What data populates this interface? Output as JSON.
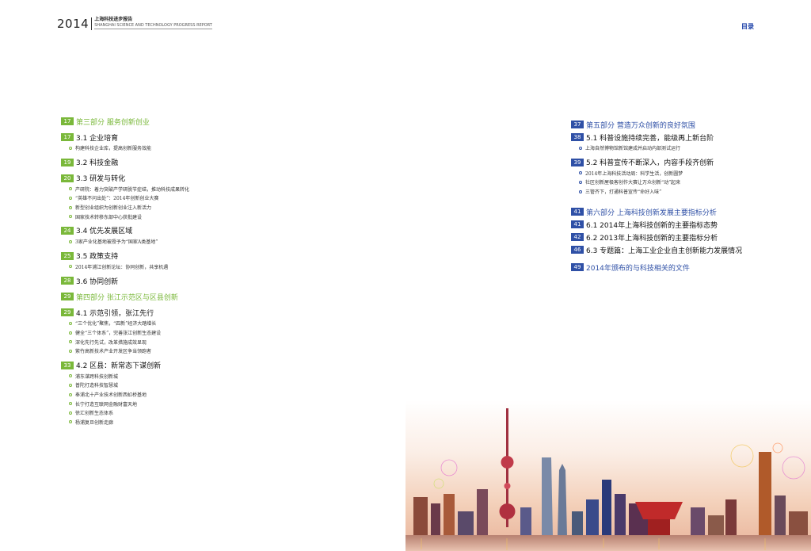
{
  "header": {
    "year": "2014",
    "title_cn": "上海科技进步报告",
    "title_en": "SHANGHAI SCIENCE AND TECHNOLOGY PROGRESS REPORT",
    "toc_link": "目录"
  },
  "left": {
    "part3": {
      "num": "17",
      "label": "第三部分 服务创新创业"
    },
    "s31": {
      "num": "17",
      "label": "3.1 企业培育",
      "items": [
        "构建科技企业库，提高创新服务效能"
      ]
    },
    "s32": {
      "num": "19",
      "label": "3.2 科技金融"
    },
    "s33": {
      "num": "20",
      "label": "3.3 研发与转化",
      "items": [
        "产研院：着力突破产学研脱节症结，推动科技成果转化",
        "“英雄不问出处”：2014年创新创业大赛",
        "新型创业组织为创新创业注入新活力",
        "国家技术转移东部中心获批建设"
      ]
    },
    "s34": {
      "num": "24",
      "label": "3.4 优先发展区域",
      "items": [
        "3家产业化基地被授予为“国家A类基地”"
      ]
    },
    "s35": {
      "num": "25",
      "label": "3.5 政策支持",
      "items": [
        "2014年浦江创新论坛：协同创新，共享机遇"
      ]
    },
    "s36": {
      "num": "28",
      "label": "3.6 协同创新"
    },
    "part4": {
      "num": "29",
      "label": "第四部分 张江示范区与区县创新"
    },
    "s41": {
      "num": "29",
      "label": "4.1 示范引领，张江先行",
      "items": [
        "“三个优化”聚焦，“四新”经济大踏增长",
        "健全“三个体系”，完善张江创新生态建设",
        "深化先行先试，改革措施成效显现",
        "紫竹高新技术产业开发区争当领跑者"
      ]
    },
    "s42": {
      "num": "33",
      "label": "4.2 区县：新常态下谋创新",
      "items": [
        "浦东谋跨科技创新城",
        "普陀打造科技智慧城",
        "奉浦北十产业技术创新西虹桥基地",
        "长宁打造互联网金融财富天地",
        "徐汇创新生态体系",
        "杨浦复旦创新走廊"
      ]
    }
  },
  "right": {
    "part5": {
      "num": "37",
      "label": "第五部分 营造万众创新的良好氛围"
    },
    "s51": {
      "num": "38",
      "label": "5.1 科普设施持续完善，能级再上新台阶",
      "items": [
        "上海自然博物馆新馆建成并启动内部测试运行"
      ]
    },
    "s52": {
      "num": "39",
      "label": "5.2 科普宣传不断深入，内容手段齐创新",
      "items": [
        "2014年上海科技活动周：科学生活，创新圆梦",
        "社区创新屋极客创作大赛让万众创新“动”起来",
        "三管齐下，打通科普宣传“命好入味”"
      ]
    },
    "part6": {
      "num": "41",
      "label": "第六部分 上海科技创新发展主要指标分析"
    },
    "s61": {
      "num": "41",
      "label": "6.1  2014年上海科技创新的主要指标态势"
    },
    "s62": {
      "num": "42",
      "label": "6.2  2013年上海科技创新的主要指标分析"
    },
    "s63": {
      "num": "46",
      "label": "6.3 专题篇：上海工业企业自主创新能力发展情况"
    },
    "docs": {
      "num": "49",
      "label": "2014年颁布的与科技相关的文件"
    }
  },
  "colors": {
    "green": "#7ab83a",
    "blue": "#2f50a6"
  }
}
